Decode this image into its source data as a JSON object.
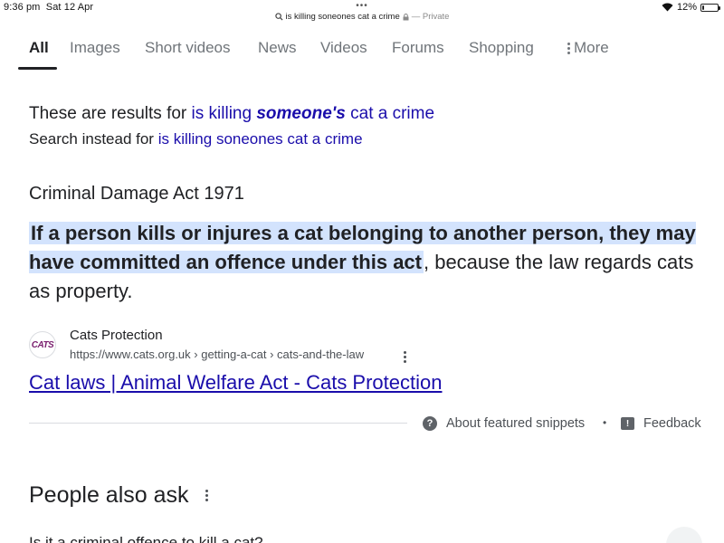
{
  "status_bar": {
    "time": "9:36 pm",
    "date": "Sat 12 Apr",
    "url": "is killing soneones cat a crime",
    "private_label": "— Private",
    "battery": "12%",
    "battery_level": 0.12
  },
  "tabs": [
    {
      "label": "All",
      "active": true
    },
    {
      "label": "Images"
    },
    {
      "label": "Short videos"
    },
    {
      "label": "News"
    },
    {
      "label": "Videos"
    },
    {
      "label": "Forums"
    },
    {
      "label": "Shopping"
    },
    {
      "label": "More"
    }
  ],
  "correction": {
    "prefix": "These are results for",
    "link_pre": "is killing",
    "link_bold": "someone's",
    "link_post": "cat a crime"
  },
  "search_instead": {
    "prefix": "Search instead for",
    "link": "is killing soneones cat a crime"
  },
  "featured_snippet": {
    "heading": "Criminal Damage Act 1971",
    "highlighted": "If a person kills or injures a cat belonging to another person, they may have committed an offence under this act",
    "rest": ", because the law regards cats as property.",
    "highlight_color": "#d3e3fd"
  },
  "source": {
    "favicon_text": "CATS",
    "name": "Cats Protection",
    "url": "https://www.cats.org.uk › getting-a-cat › cats-and-the-law",
    "title": "Cat laws | Animal Welfare Act - Cats Protection"
  },
  "snippet_footer": {
    "about": "About featured snippets",
    "separator": "•",
    "feedback": "Feedback"
  },
  "people_also_ask": {
    "heading": "People also ask",
    "first_question": "Is it a criminal offence to kill a cat?"
  },
  "colors": {
    "link": "#1a0dab",
    "text": "#202124",
    "muted": "#70757a"
  }
}
